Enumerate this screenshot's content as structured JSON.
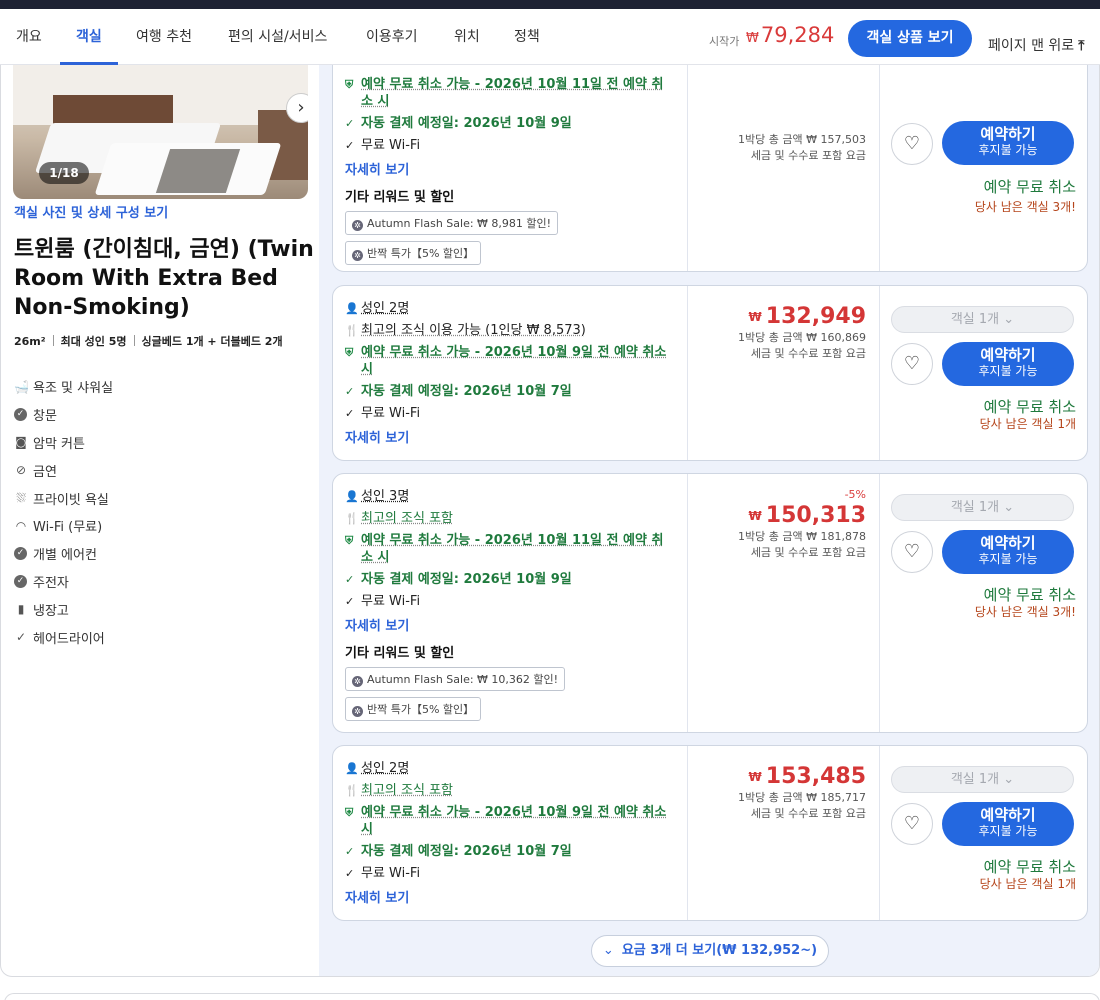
{
  "nav": {
    "tabs": [
      "개요",
      "객실",
      "여행 추천",
      "편의 시설/서비스",
      "이용후기",
      "위치",
      "정책"
    ],
    "start_label": "시작가",
    "currency": "₩",
    "start_price": "79,284",
    "view_rooms": "객실 상품 보기",
    "back_to_top": "페이지 맨 위로",
    "back_to_top_icon": "arrow-up-icon"
  },
  "room": {
    "photo_counter": "1/18",
    "photo_link": "객실 사진 및 상세 구성 보기",
    "title": "트윈룸 (간이침대, 금연) (Twin Room With Extra Bed Non-Smoking)",
    "size": "26m²",
    "max_guests": "최대 성인 5명",
    "beds": "싱글베드 1개 + 더블베드 2개",
    "amenities": [
      {
        "icon": "bath-icon",
        "label": "욕조 및 샤워실"
      },
      {
        "icon": "window-icon",
        "label": "창문"
      },
      {
        "icon": "curtain-icon",
        "label": "암막 커튼"
      },
      {
        "icon": "no-smoking-icon",
        "label": "금연"
      },
      {
        "icon": "shower-icon",
        "label": "프라이빗 욕실"
      },
      {
        "icon": "wifi-icon",
        "label": "Wi-Fi (무료)"
      },
      {
        "icon": "ac-icon",
        "label": "개별 에어컨"
      },
      {
        "icon": "kettle-icon",
        "label": "주전자"
      },
      {
        "icon": "fridge-icon",
        "label": "냉장고"
      },
      {
        "icon": "check-icon",
        "label": "헤어드라이어"
      }
    ]
  },
  "offers": [
    {
      "cancel": "예약 무료 취소 가능 - 2026년 10월 11일 전 예약 취소 시",
      "pay": "자동 결제 예정일: 2026년 10월 9일",
      "wifi": "무료 Wi-Fi",
      "more": "자세히 보기",
      "rewards_title": "기타 리워드 및 할인",
      "chips": [
        "Autumn Flash Sale: ₩ 8,981 할인!",
        "반짝 특가【5% 할인】"
      ],
      "price_sub1": "1박당 총 금액 ₩ 157,503",
      "price_sub2": "세금 및 수수료 포함 요금",
      "book": "예약하기",
      "book_sub": "후지불 가능",
      "free_cancel": "예약 무료 취소",
      "rooms_left": "당사 남은 객실 3개!"
    },
    {
      "adults": "성인 2명",
      "breakfast": "최고의 조식 이용 가능 (1인당 ₩ 8,573)",
      "cancel": "예약 무료 취소 가능 - 2026년 10월 9일 전 예약 취소 시",
      "pay": "자동 결제 예정일: 2026년 10월 7일",
      "wifi": "무료 Wi-Fi",
      "more": "자세히 보기",
      "price": "132,949",
      "price_sub1": "1박당 총 금액 ₩ 160,869",
      "price_sub2": "세금 및 수수료 포함 요금",
      "room_select": "객실 1개",
      "book": "예약하기",
      "book_sub": "후지불 가능",
      "free_cancel": "예약 무료 취소",
      "rooms_left": "당사 남은 객실 1개"
    },
    {
      "adults": "성인 3명",
      "breakfast": "최고의 조식 포함",
      "cancel": "예약 무료 취소 가능 - 2026년 10월 11일 전 예약 취소 시",
      "pay": "자동 결제 예정일: 2026년 10월 9일",
      "wifi": "무료 Wi-Fi",
      "more": "자세히 보기",
      "rewards_title": "기타 리워드 및 할인",
      "chips": [
        "Autumn Flash Sale: ₩ 10,362 할인!",
        "반짝 특가【5% 할인】"
      ],
      "discount": "-5%",
      "price": "150,313",
      "price_sub1": "1박당 총 금액 ₩ 181,878",
      "price_sub2": "세금 및 수수료 포함 요금",
      "room_select": "객실 1개",
      "book": "예약하기",
      "book_sub": "후지불 가능",
      "free_cancel": "예약 무료 취소",
      "rooms_left": "당사 남은 객실 3개!"
    },
    {
      "adults": "성인 2명",
      "breakfast": "최고의 조식 포함",
      "cancel": "예약 무료 취소 가능 - 2026년 10월 9일 전 예약 취소 시",
      "pay": "자동 결제 예정일: 2026년 10월 7일",
      "wifi": "무료 Wi-Fi",
      "more": "자세히 보기",
      "price": "153,485",
      "price_sub1": "1박당 총 금액 ₩ 185,717",
      "price_sub2": "세금 및 수수료 포함 요금",
      "room_select": "객실 1개",
      "book": "예약하기",
      "book_sub": "후지불 가능",
      "free_cancel": "예약 무료 취소",
      "rooms_left": "당사 남은 객실 1개"
    }
  ],
  "show_more": "요금 3개 더 보기(₩ 132,952~)",
  "colors": {
    "accent": "#2468e0",
    "price": "#d43636",
    "green": "#1f7a3d",
    "nav_dark": "#1e2233"
  }
}
